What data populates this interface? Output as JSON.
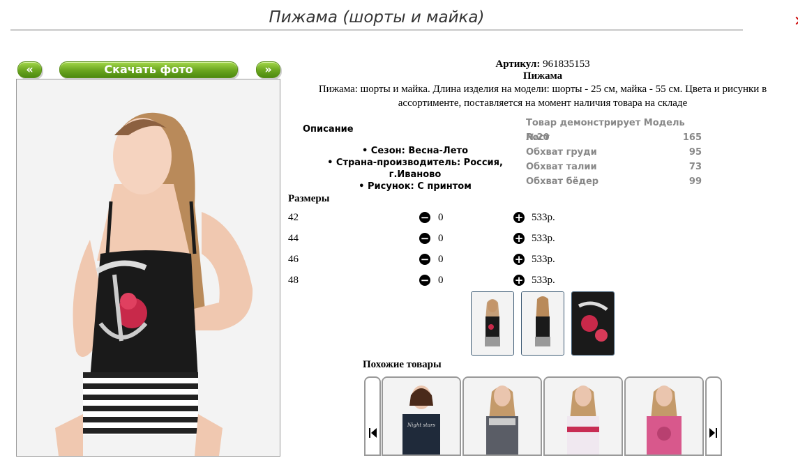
{
  "product": {
    "title": "Пижама (шорты и майка)",
    "article_label": "Артикул:",
    "article_value": "961835153",
    "name": "Пижама",
    "description": "Пижама: шорты и майка. Длина изделия на модели: шорты - 25 см, майка - 55 см. Цвета и рисунки в ассортименте, поставляется на момент наличия товара на складе"
  },
  "nav": {
    "prev_label": "«",
    "download_label": "Скачать фото",
    "next_label": "»"
  },
  "details": {
    "heading": "Описание",
    "season": "• Сезон: Весна-Лето",
    "country": "• Страна-производитель: Россия, г.Иваново",
    "pattern": "• Рисунок: С принтом"
  },
  "measurements": {
    "model_label": "Товар демонстрирует Модель №20",
    "rows": [
      {
        "label": "Рост",
        "value": "165"
      },
      {
        "label": "Обхват груди",
        "value": "95"
      },
      {
        "label": "Обхват талии",
        "value": "73"
      },
      {
        "label": "Обхват бёдер",
        "value": "99"
      }
    ]
  },
  "sizes": {
    "heading": "Размеры",
    "rows": [
      {
        "size": "42",
        "qty": "0",
        "price": "533р."
      },
      {
        "size": "44",
        "qty": "0",
        "price": "533р."
      },
      {
        "size": "46",
        "qty": "0",
        "price": "533р."
      },
      {
        "size": "48",
        "qty": "0",
        "price": "533р."
      }
    ]
  },
  "similar": {
    "heading": "Похожие товары",
    "print_text": "Night stars"
  },
  "colors": {
    "button_green": "#6aa51f",
    "thumb_border": "#3c5a74"
  },
  "icons": {
    "minus": "minus-circle-icon",
    "plus": "plus-circle-icon",
    "nav_left": "skip-back-icon",
    "nav_right": "skip-forward-icon"
  }
}
